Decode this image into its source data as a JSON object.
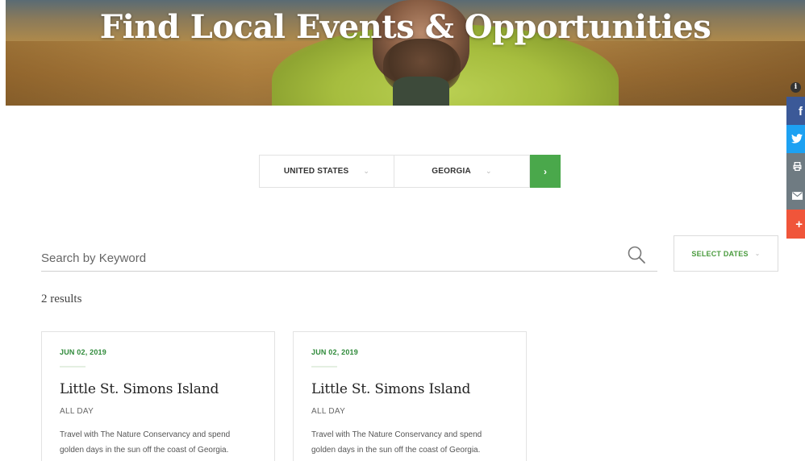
{
  "hero": {
    "title": "Find Local Events & Opportunities"
  },
  "share": {
    "info": "i",
    "items": [
      {
        "label": "f"
      },
      {
        "label": "t"
      },
      {
        "label": "⎙"
      },
      {
        "label": "✉"
      },
      {
        "label": "+"
      }
    ],
    "colors": {
      "facebook": "#3b5998",
      "twitter": "#1da1f2",
      "print": "#6f7b82",
      "email": "#6f7b82",
      "more": "#f0553a"
    }
  },
  "location": {
    "country": "UNITED STATES",
    "state": "GEORGIA",
    "go_label": "›",
    "accent": "#4aa84b"
  },
  "search": {
    "placeholder": "Search by Keyword",
    "value": "",
    "dates_label": "SELECT DATES"
  },
  "results": {
    "count_text": "2 results"
  },
  "cards": [
    {
      "date": "JUN 02, 2019",
      "title": "Little St. Simons Island",
      "time": "ALL DAY",
      "desc": "Travel with The Nature Conservancy and spend golden days in the sun off the coast of Georgia."
    },
    {
      "date": "JUN 02, 2019",
      "title": "Little St. Simons Island",
      "time": "ALL DAY",
      "desc": "Travel with The Nature Conservancy and spend golden days in the sun off the coast of Georgia."
    }
  ]
}
